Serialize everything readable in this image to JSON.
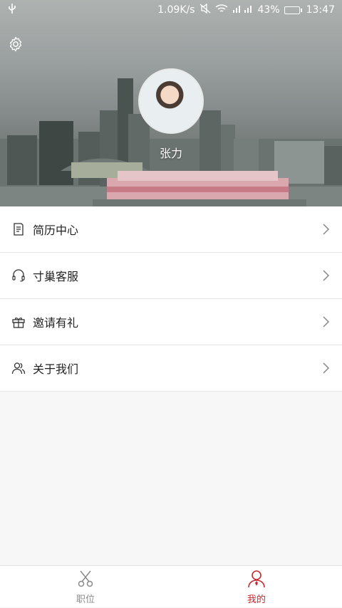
{
  "status_bar": {
    "speed": "1.09K/s",
    "battery_percent": "43%",
    "battery_level": 0.43,
    "time": "13:47"
  },
  "profile": {
    "name": "张力"
  },
  "menu": {
    "items": [
      {
        "label": "简历中心",
        "icon": "resume-icon"
      },
      {
        "label": "寸巢客服",
        "icon": "headset-icon"
      },
      {
        "label": "邀请有礼",
        "icon": "gift-icon"
      },
      {
        "label": "关于我们",
        "icon": "users-icon"
      }
    ]
  },
  "tabs": [
    {
      "label": "职位",
      "icon": "scissors-icon",
      "active": false
    },
    {
      "label": "我的",
      "icon": "person-icon",
      "active": true
    }
  ],
  "colors": {
    "accent": "#c8282d",
    "inactive": "#8a8a8a"
  }
}
